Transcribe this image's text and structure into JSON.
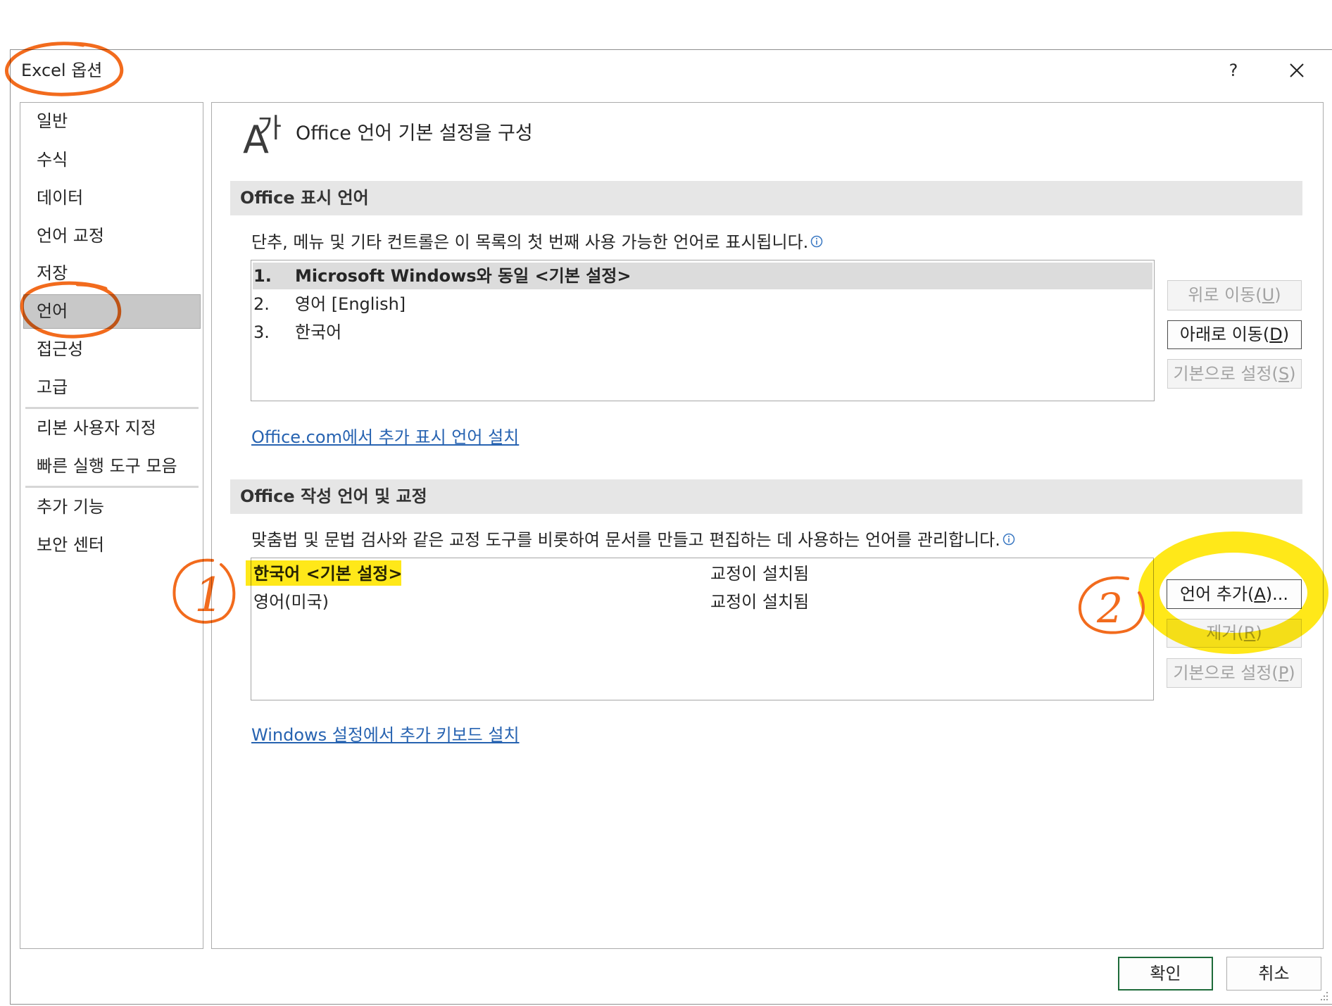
{
  "window": {
    "title": "Excel 옵션",
    "help_label": "?",
    "close_icon": "close-icon"
  },
  "sidebar": {
    "items": [
      {
        "label": "일반"
      },
      {
        "label": "수식"
      },
      {
        "label": "데이터"
      },
      {
        "label": "언어 교정"
      },
      {
        "label": "저장"
      },
      {
        "label": "언어",
        "selected": true
      },
      {
        "label": "접근성"
      },
      {
        "label": "고급"
      },
      {
        "label": "리본 사용자 지정"
      },
      {
        "label": "빠른 실행 도구 모음"
      },
      {
        "label": "추가 기능"
      },
      {
        "label": "보안 센터"
      }
    ]
  },
  "page": {
    "icon": {
      "latin": "A",
      "hangul": "가",
      "name": "language-icon"
    },
    "title": "Office 언어 기본 설정을 구성"
  },
  "display_language": {
    "heading": "Office 표시 언어",
    "description": "단추, 메뉴 및 기타 컨트롤은 이 목록의 첫 번째 사용 가능한 언어로 표시됩니다.",
    "items": [
      {
        "number": "1.",
        "label": "Microsoft Windows와 동일 <기본 설정>",
        "selected": true
      },
      {
        "number": "2.",
        "label": "영어 [English]",
        "selected": false
      },
      {
        "number": "3.",
        "label": "한국어",
        "selected": false
      }
    ],
    "buttons": [
      {
        "text": "위로 이동(",
        "access_key": "U",
        "suffix": ")",
        "enabled": false
      },
      {
        "text": "아래로 이동(",
        "access_key": "D",
        "suffix": ")",
        "enabled": true
      },
      {
        "text": "기본으로 설정(",
        "access_key": "S",
        "suffix": ")",
        "enabled": false
      }
    ],
    "link": "Office.com에서 추가 표시 언어 설치"
  },
  "authoring_language": {
    "heading": "Office 작성 언어 및 교정",
    "description": "맞춤법 및 문법 검사와 같은 교정 도구를 비롯하여 문서를 만들고 편집하는 데 사용하는 언어를 관리합니다.",
    "items": [
      {
        "language": "한국어 <기본 설정>",
        "status": "교정이 설치됨",
        "default": true
      },
      {
        "language": "영어(미국)",
        "status": "교정이 설치됨",
        "default": false
      }
    ],
    "buttons": [
      {
        "text": "언어 추가(",
        "access_key": "A",
        "suffix": ")...",
        "enabled": true
      },
      {
        "text": "제거(",
        "access_key": "R",
        "suffix": ")",
        "enabled": false
      },
      {
        "text": "기본으로 설정(",
        "access_key": "P",
        "suffix": ")",
        "enabled": false
      }
    ],
    "link": "Windows 설정에서 추가 키보드 설치"
  },
  "footer": {
    "ok_label": "확인",
    "cancel_label": "취소"
  },
  "annotations": {
    "marker_1": "1",
    "marker_2": "2",
    "pen_color": "#f26b1d",
    "highlighter_color": "#ffe600"
  },
  "colors": {
    "ok_border": "#1e6b3a",
    "link": "#2763b1",
    "selected_row_bg": "#dcdcdc",
    "info_icon": "#3a78c2"
  }
}
